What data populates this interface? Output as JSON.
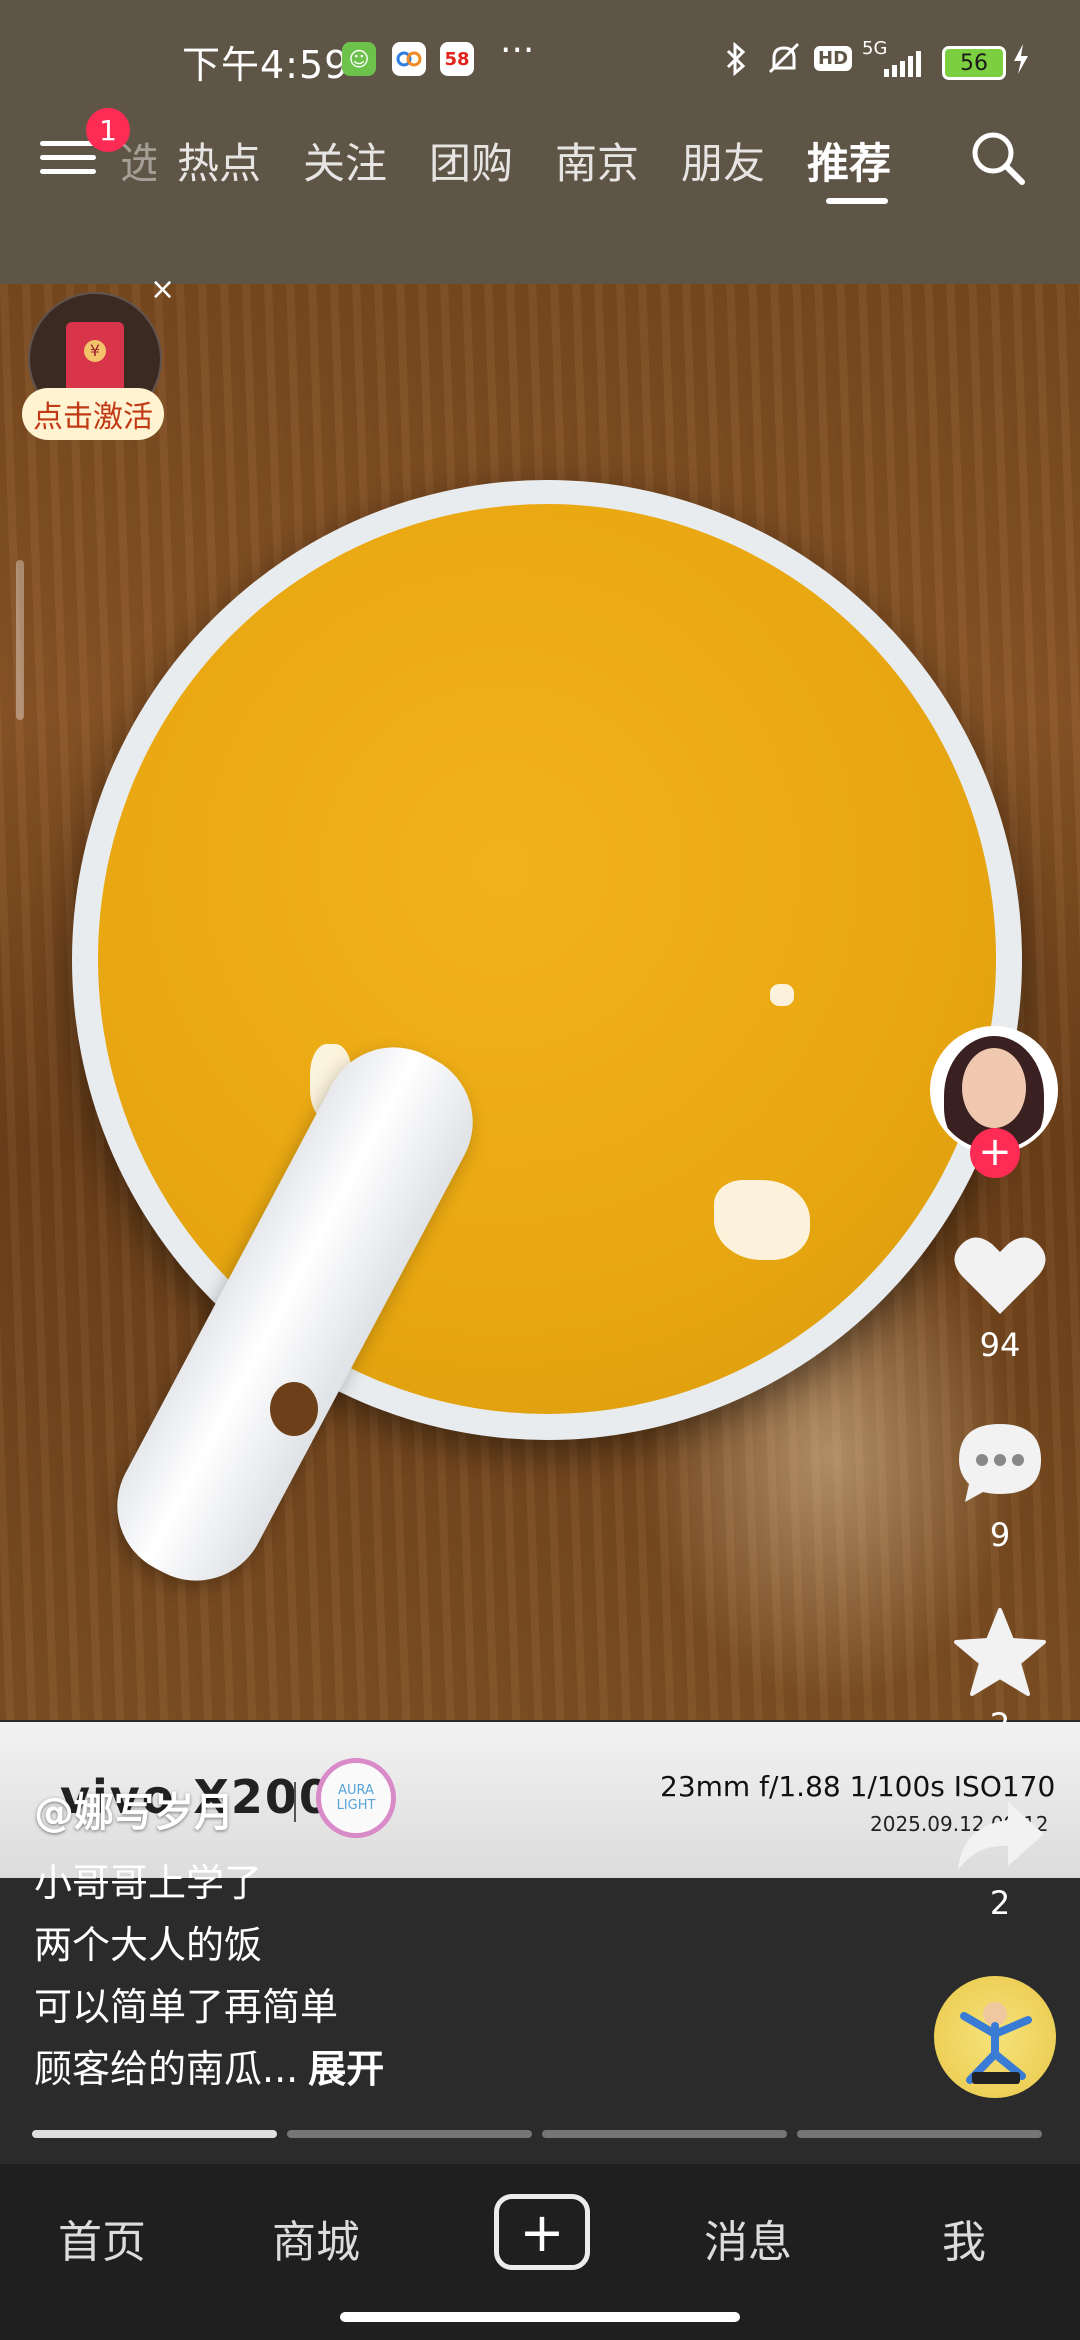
{
  "status_bar": {
    "time": "下午4:59",
    "app_icons": [
      "app-notification-icon",
      "app-notification-icon",
      "58-app-icon"
    ],
    "app58_label": "58",
    "more": "···",
    "network": "5G",
    "hd": "HD",
    "battery": "56"
  },
  "top_nav": {
    "badge": "1",
    "partial_tab": "选",
    "tabs": [
      "热点",
      "关注",
      "团购",
      "南京",
      "朋友",
      "推荐"
    ],
    "active_tab": "推荐"
  },
  "redpacket": {
    "close": "×",
    "label": "点击激活"
  },
  "side_actions": {
    "follow": "+",
    "likes": "94",
    "comments": "9",
    "favorites": "2",
    "shares": "2"
  },
  "watermark": {
    "brand": "vivo X200",
    "aura_line1": "AURA",
    "aura_line2": "LIGHT",
    "params": "23mm  f/1.88  1/100s  ISO170",
    "date": "2025.09.12 09:12"
  },
  "caption": {
    "author": "@娜写岁月",
    "lines": [
      "小哥哥上学了",
      "两个大人的饭",
      "可以简单了再简单"
    ],
    "last_line": "顾客给的南瓜...",
    "expand": "展开"
  },
  "progress": {
    "segments": 4,
    "active": 1
  },
  "bottom_nav": {
    "home": "首页",
    "mall": "商城",
    "messages": "消息",
    "me": "我"
  }
}
